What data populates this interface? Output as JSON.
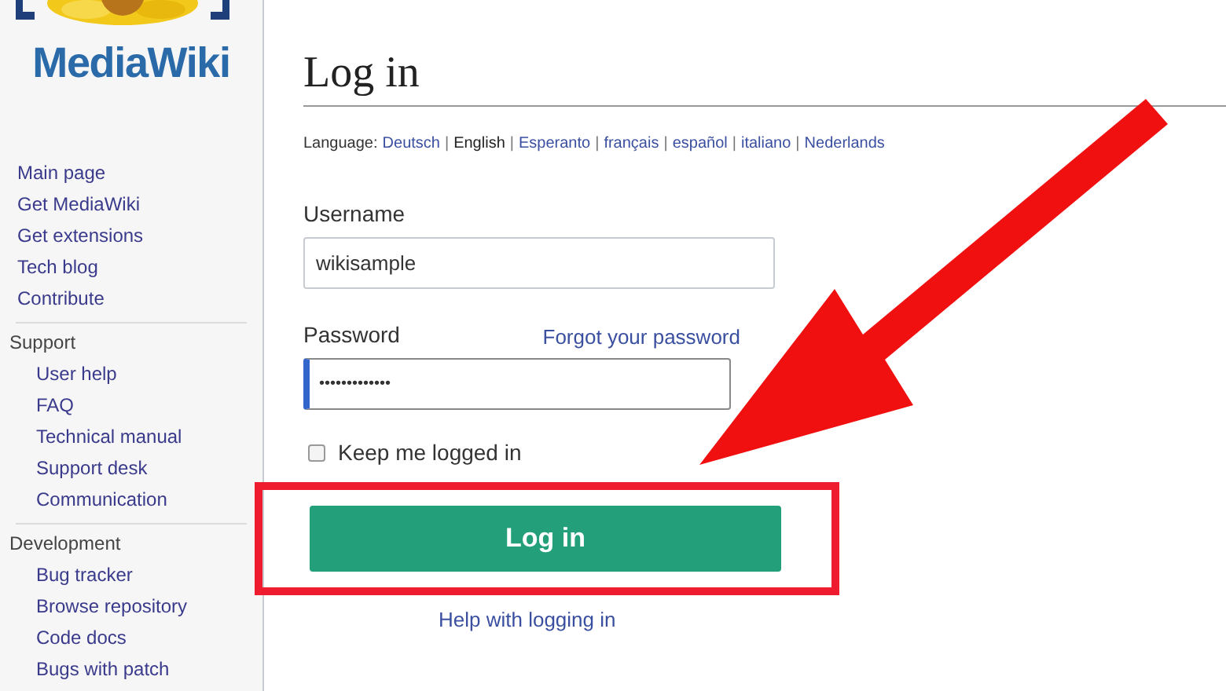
{
  "sidebar": {
    "logo_text": "MediaWiki",
    "navigation": [
      "Main page",
      "Get MediaWiki",
      "Get extensions",
      "Tech blog",
      "Contribute"
    ],
    "sections": [
      {
        "heading": "Support",
        "items": [
          "User help",
          "FAQ",
          "Technical manual",
          "Support desk",
          "Communication"
        ]
      },
      {
        "heading": "Development",
        "items": [
          "Bug tracker",
          "Browse repository",
          "Code docs",
          "Bugs with patch"
        ]
      }
    ]
  },
  "page": {
    "title": "Log in",
    "language_label": "Language:",
    "languages": [
      {
        "label": "Deutsch",
        "selected": false
      },
      {
        "separator": "|",
        "label": "English",
        "selected": true
      },
      {
        "separator": "|",
        "label": "Esperanto",
        "selected": false
      },
      {
        "separator": "|",
        "label": "français",
        "selected": false
      },
      {
        "separator": "|",
        "label": "español",
        "selected": false
      },
      {
        "separator": "|",
        "label": "italiano",
        "selected": false
      },
      {
        "separator": "|",
        "label": "Nederlands",
        "selected": false
      }
    ],
    "username": {
      "label": "Username",
      "value": "wikisample"
    },
    "password": {
      "label": "Password",
      "value": "•••••••••••••",
      "focused": true
    },
    "forgot_link": "Forgot your password",
    "keep_logged_in": {
      "label": "Keep me logged in",
      "checked": false
    },
    "login_button": "Log in",
    "help_link": "Help with logging in"
  },
  "annotation": {
    "highlight_box": true,
    "arrow": true
  }
}
